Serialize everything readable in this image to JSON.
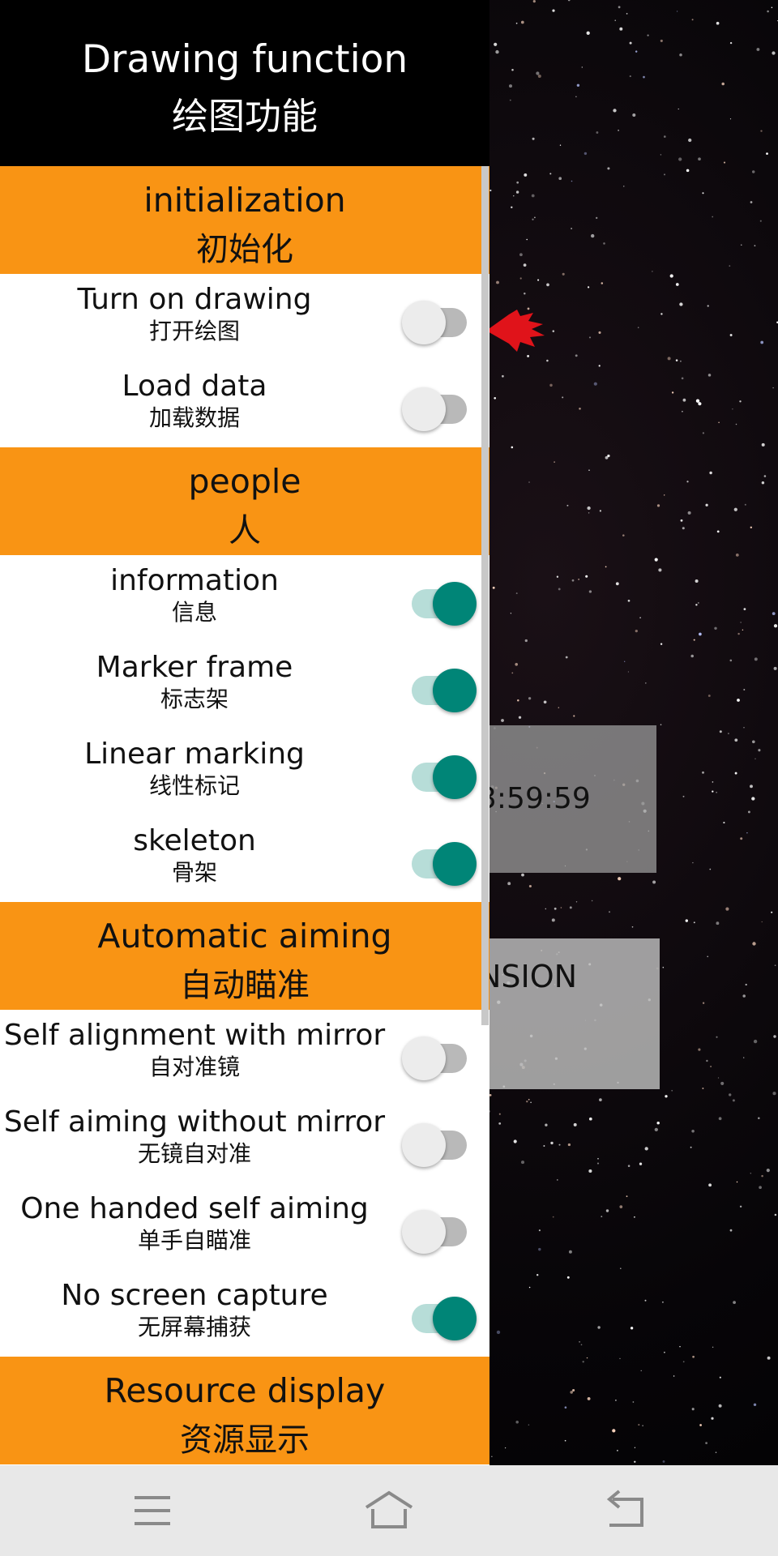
{
  "panel": {
    "title_en": "Drawing function",
    "title_zh": "绘图功能",
    "sections": [
      {
        "title_en": "initialization",
        "title_zh": "初始化",
        "rows": [
          {
            "en": "Turn on drawing",
            "zh": "打开绘图",
            "on": false
          },
          {
            "en": "Load data",
            "zh": "加载数据",
            "on": false
          }
        ]
      },
      {
        "title_en": "people",
        "title_zh": "人",
        "rows": [
          {
            "en": "information",
            "zh": "信息",
            "on": true
          },
          {
            "en": "Marker frame",
            "zh": "标志架",
            "on": true
          },
          {
            "en": "Linear marking",
            "zh": "线性标记",
            "on": true
          },
          {
            "en": "skeleton",
            "zh": "骨架",
            "on": true
          }
        ]
      },
      {
        "title_en": "Automatic aiming",
        "title_zh": "自动瞄准",
        "rows": [
          {
            "en": "Self alignment with mirror",
            "zh": "自对准镜",
            "on": false
          },
          {
            "en": "Self aiming without mirror",
            "zh": "无镜自对准",
            "on": false
          },
          {
            "en": "One handed self aiming",
            "zh": "单手自瞄准",
            "on": false
          },
          {
            "en": "No screen capture",
            "zh": "无屏幕捕获",
            "on": true
          }
        ]
      },
      {
        "title_en": "Resource display",
        "title_zh": "资源显示",
        "rows": []
      }
    ]
  },
  "background": {
    "timer_text": "3:59:59",
    "dimension_text": "NSION"
  },
  "colors": {
    "section_bg": "#f99414",
    "switch_on": "#008577",
    "switch_on_track": "#b7ddd8",
    "switch_off_thumb": "#ececec",
    "switch_off_track": "#b9b9b9",
    "header_bg": "#000000",
    "navbar_bg": "#e8e8e8"
  },
  "navbar": {
    "menu_icon": "menu-icon",
    "home_icon": "home-icon",
    "back_icon": "back-icon"
  }
}
